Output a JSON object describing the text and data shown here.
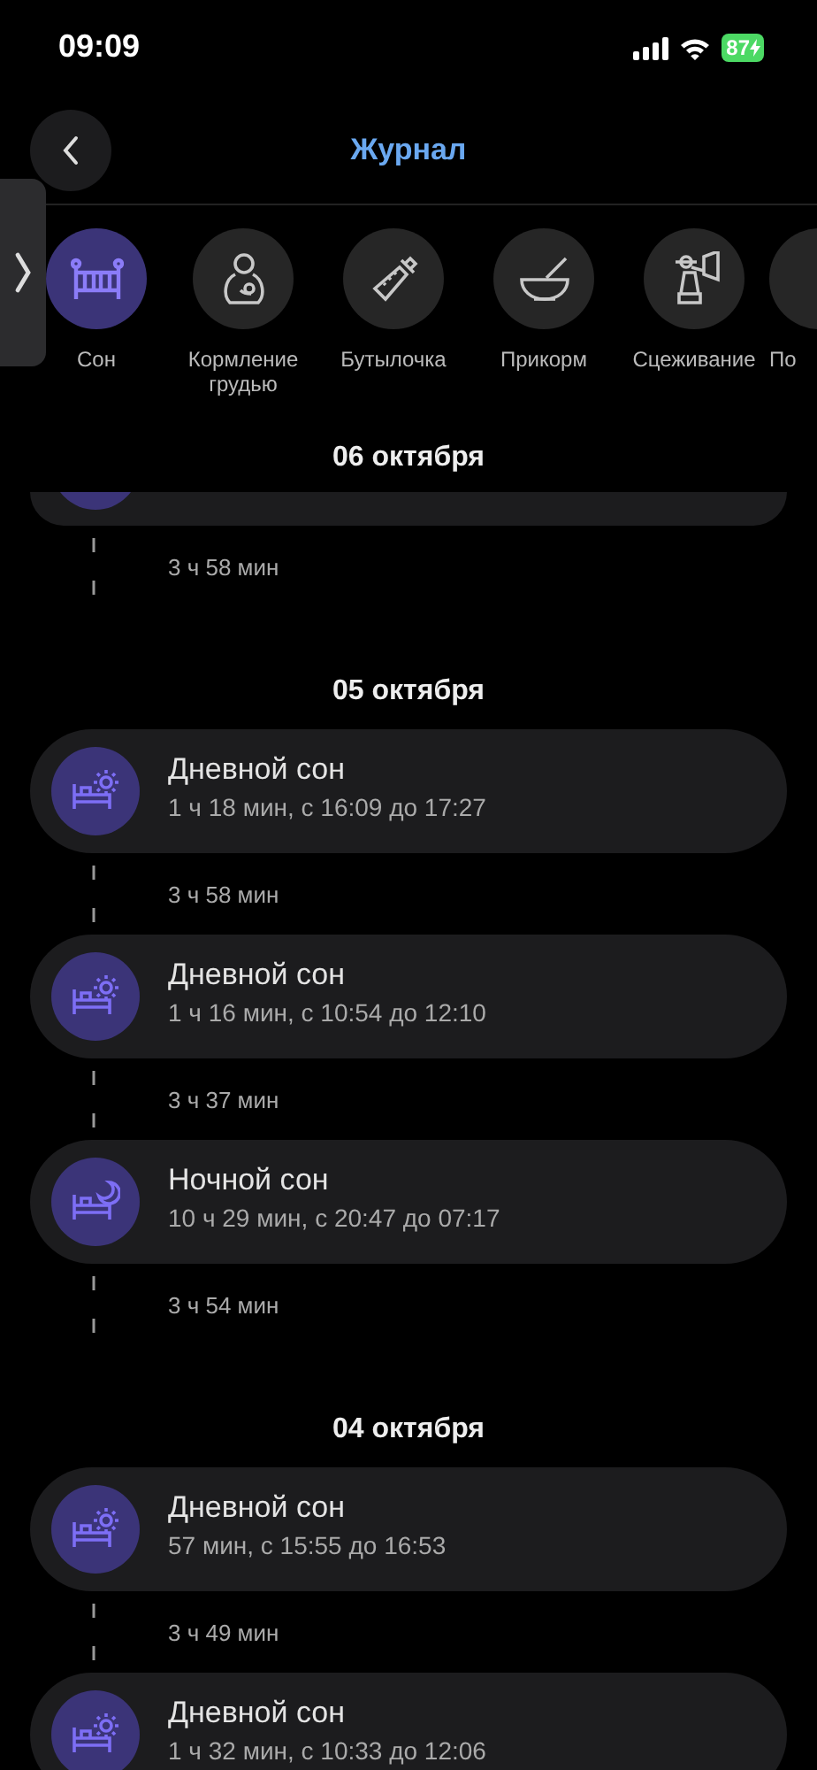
{
  "status_bar": {
    "time": "09:09",
    "battery": "87"
  },
  "header": {
    "title": "Журнал"
  },
  "categories": [
    {
      "kind": "sleep",
      "label": "Сон",
      "selected": true
    },
    {
      "kind": "breastfeeding",
      "label": "Кормление грудью",
      "selected": false
    },
    {
      "kind": "bottle",
      "label": "Бутылочка",
      "selected": false
    },
    {
      "kind": "solids",
      "label": "Прикорм",
      "selected": false
    },
    {
      "kind": "pumping",
      "label": "Сцеживание",
      "selected": false
    },
    {
      "kind": "unknown",
      "label": "По",
      "selected": false
    }
  ],
  "sticky_date": "06 октября",
  "feed": [
    {
      "kind": "partial"
    },
    {
      "kind": "gap",
      "text": "3 ч 58 мин"
    },
    {
      "kind": "date",
      "text": "05 октября"
    },
    {
      "kind": "day",
      "title": "Дневной сон",
      "details": "1 ч 18 мин, с 16:09 до 17:27"
    },
    {
      "kind": "gap",
      "text": "3 ч 58 мин"
    },
    {
      "kind": "day",
      "title": "Дневной сон",
      "details": "1 ч 16 мин, с 10:54 до 12:10"
    },
    {
      "kind": "gap",
      "text": "3 ч 37 мин"
    },
    {
      "kind": "night",
      "title": "Ночной сон",
      "details": "10 ч 29 мин, с 20:47 до 07:17"
    },
    {
      "kind": "gap",
      "text": "3 ч 54 мин"
    },
    {
      "kind": "date",
      "text": "04 октября"
    },
    {
      "kind": "day",
      "title": "Дневной сон",
      "details": "57 мин, с 15:55 до 16:53"
    },
    {
      "kind": "gap",
      "text": "3 ч 49 мин"
    },
    {
      "kind": "day",
      "title": "Дневной сон",
      "details": "1 ч 32 мин, с 10:33 до 12:06"
    }
  ]
}
